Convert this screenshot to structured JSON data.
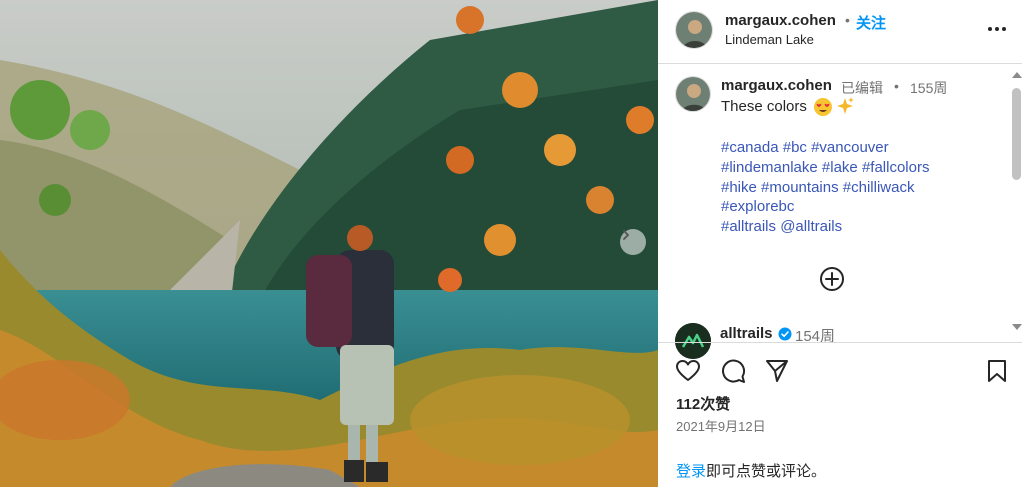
{
  "header": {
    "username": "margaux.cohen",
    "dot": "•",
    "follow_label": "关注",
    "location": "Lindeman Lake",
    "more_icon": "more-horizontal-icon"
  },
  "caption": {
    "username": "margaux.cohen",
    "edited": "已编辑",
    "separator": "•",
    "time": "155周",
    "text": "These colors",
    "emojis": [
      "heart-eyes-emoji",
      "sparkles-emoji"
    ],
    "hashtag_lines": [
      [
        "#canada",
        "#bc",
        "#vancouver"
      ],
      [
        "#lindemanlake",
        "#lake",
        "#fallcolors"
      ],
      [
        "#hike",
        "#mountains",
        "#chilliwack"
      ],
      [
        "#explorebc"
      ],
      [
        "#alltrails",
        "@alltrails"
      ]
    ]
  },
  "comments": [
    {
      "username": "alltrails",
      "verified": true,
      "time": "154周"
    }
  ],
  "actions": {
    "like_icon": "heart-icon",
    "comment_icon": "comment-icon",
    "share_icon": "send-icon",
    "save_icon": "bookmark-icon"
  },
  "likes": "112次赞",
  "date": "2021年9月12日",
  "login": {
    "link": "登录",
    "rest": "即可点赞或评论。"
  },
  "colors": {
    "link_blue": "#0095f6",
    "hashtag_blue": "#3a57b7",
    "muted_gray": "#737373",
    "text_dark": "#262626",
    "divider": "#dbdbdb"
  }
}
